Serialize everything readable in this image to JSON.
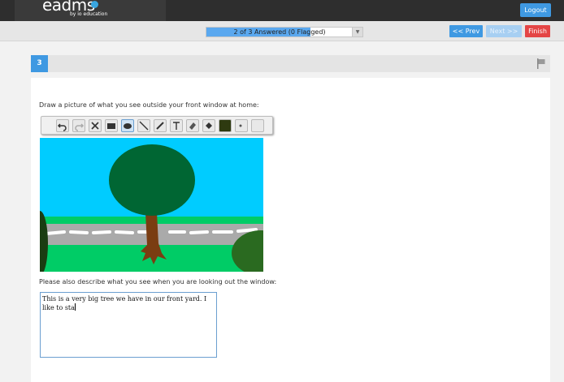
{
  "header": {
    "logo_text": "eadms",
    "logo_sub": "by io education",
    "logout_label": "Logout"
  },
  "nav": {
    "progress_text": "2 of 3 Answered (0 Flagged)",
    "progress_fraction": 0.667,
    "prev_label": "<< Prev",
    "next_label": "Next >>",
    "finish_label": "Finish"
  },
  "question": {
    "number": "3",
    "prompt_drawing": "Draw a picture of what you see outside your front window at home:",
    "prompt_text": "Please also describe what you see when you are looking out the window:",
    "answer_text": "This is a very big tree we have in our front yard. I like to sta",
    "tools": [
      "undo-icon",
      "redo-icon",
      "clear-icon",
      "rectangle-icon",
      "ellipse-icon",
      "line-icon",
      "pencil-icon",
      "text-icon",
      "eraser-icon",
      "fill-icon",
      "color-swatch",
      "brush-size-icon",
      "blank-tool"
    ],
    "selected_color": "#2e3a10"
  },
  "colors": {
    "accent": "#3f99e2",
    "finish": "#e44545",
    "sky": "#00ccff",
    "grass": "#00cc66",
    "road": "#aaaaaa",
    "tree_crown": "#006633",
    "trunk": "#7a3d12"
  }
}
